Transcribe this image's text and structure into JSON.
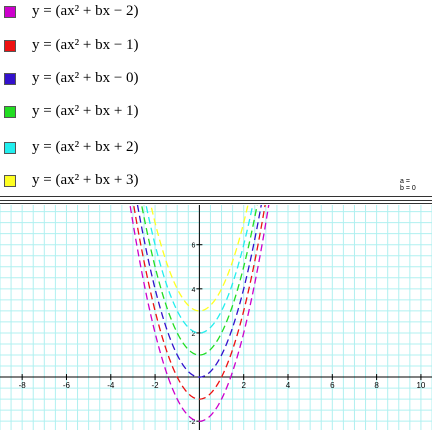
{
  "legend": {
    "items": [
      {
        "label": "y = (ax² + bx − 2)",
        "color": "#cc00cc"
      },
      {
        "label": "y = (ax² + bx − 1)",
        "color": "#ee1111"
      },
      {
        "label": "y = (ax² + bx − 0)",
        "color": "#3311cc"
      },
      {
        "label": "y = (ax² + bx + 1)",
        "color": "#22dd22"
      },
      {
        "label": "y = (ax² + bx + 2)",
        "color": "#22eeee"
      },
      {
        "label": "y = (ax² + bx + 3)",
        "color": "#ffff22"
      }
    ],
    "corner_note": "a =\nb = 0"
  },
  "colors": {
    "grid": "#b0f0f0",
    "axis": "#000000",
    "background": "#ffffff"
  },
  "chart_data": {
    "type": "line",
    "title": "",
    "xlabel": "",
    "ylabel": "",
    "xlim": [
      -9,
      10.5
    ],
    "ylim": [
      -2.4,
      7.8
    ],
    "grid": true,
    "x_ticks": [
      -8,
      -6,
      -4,
      -2,
      2,
      4,
      6,
      8,
      10
    ],
    "y_ticks": [
      -2,
      2,
      4,
      6
    ],
    "legend_placement": "top",
    "line_style": "dashed",
    "series": [
      {
        "label": "y = (ax² + bx − 2)",
        "color": "#cc00cc",
        "a": 1,
        "b": 0,
        "c": -2
      },
      {
        "label": "y = (ax² + bx − 1)",
        "color": "#ee1111",
        "a": 1,
        "b": 0,
        "c": -1
      },
      {
        "label": "y = (ax² + bx − 0)",
        "color": "#3311cc",
        "a": 1,
        "b": 0,
        "c": 0
      },
      {
        "label": "y = (ax² + bx + 1)",
        "color": "#22dd22",
        "a": 1,
        "b": 0,
        "c": 1
      },
      {
        "label": "y = (ax² + bx + 2)",
        "color": "#22eeee",
        "a": 1,
        "b": 0,
        "c": 2
      },
      {
        "label": "y = (ax² + bx + 3)",
        "color": "#ffff22",
        "a": 1,
        "b": 0,
        "c": 3
      }
    ]
  }
}
